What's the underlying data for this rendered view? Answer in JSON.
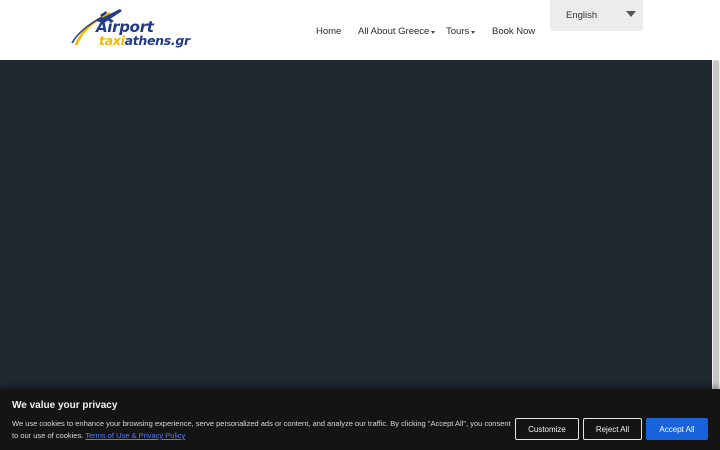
{
  "header": {
    "logo": {
      "line1": "Airport",
      "line2_highlight": "taxi",
      "line2_rest": "athens.gr"
    },
    "nav": [
      {
        "label": "Home",
        "has_dropdown": false
      },
      {
        "label": "All About Greece",
        "has_dropdown": true
      },
      {
        "label": "Tours",
        "has_dropdown": true
      },
      {
        "label": "Book Now",
        "has_dropdown": false
      }
    ],
    "language": {
      "selected": "English",
      "icon": "dropdown-triangle-icon"
    }
  },
  "cookie_banner": {
    "title": "We value your privacy",
    "text": "We use cookies to enhance your browsing experience, serve personalized ads or content, and analyze our traffic. By clicking \"Accept All\", you consent to our use of cookies.",
    "link_text": "Terms of Use & Privacy Policy",
    "buttons": {
      "customize": "Customize",
      "reject": "Reject All",
      "accept": "Accept All"
    }
  },
  "colors": {
    "brand_blue": "#1f3a8a",
    "brand_yellow": "#f5b800",
    "hero_bg": "#1e2830",
    "banner_bg": "#141414",
    "accept_button": "#1863dc",
    "link": "#4f7cff"
  }
}
